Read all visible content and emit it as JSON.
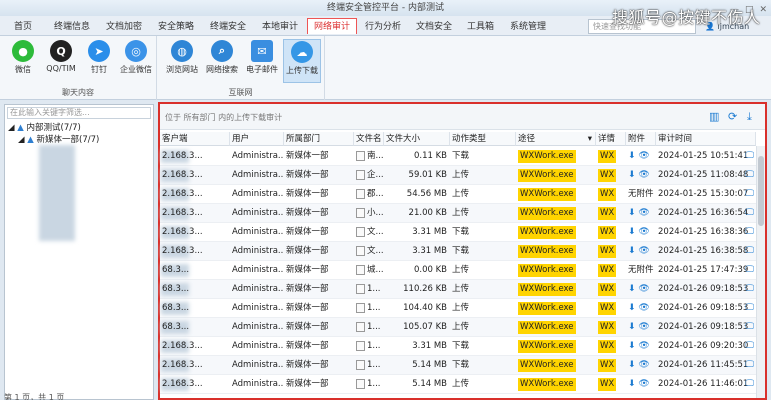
{
  "window": {
    "title": "终端安全管控平台 - 内部测试",
    "watermark": "搜狐号@按键不伤人"
  },
  "menu": {
    "items": [
      "首页",
      "终端信息",
      "文档加密",
      "安全策略",
      "终端安全",
      "本地审计",
      "网络审计",
      "行为分析",
      "文档安全",
      "工具箱",
      "系统管理"
    ],
    "active_index": 6,
    "search_placeholder": "快速查找功能",
    "user": "ljmchan"
  },
  "ribbon": {
    "groups": [
      {
        "label": "聊天内容",
        "buttons": [
          "微信",
          "QQ/TIM",
          "钉钉",
          "企业微信"
        ]
      },
      {
        "label": "互联网",
        "buttons": [
          "浏览网站",
          "网络搜索",
          "电子邮件",
          "上传下载"
        ]
      }
    ],
    "active_button": "上传下载"
  },
  "tree": {
    "search_placeholder": "在此输入关键字筛选...",
    "root": "内部测试(7/7)",
    "child": "新媒体一部(7/7)"
  },
  "main": {
    "breadcrumb": "位于 所有部门 内的上传下载审计",
    "columns": [
      "客户端",
      "用户",
      "所属部门",
      "文件名",
      "文件大小",
      "动作类型",
      "途径",
      "详情",
      "附件",
      "审计时间"
    ],
    "rows": [
      {
        "client": "2.168.3...",
        "user": "Administra...",
        "dept": "新媒体一部",
        "file": "南...",
        "size": "0.11 KB",
        "action": "下载",
        "path": "WXWork.exe",
        "detail": "WX",
        "attach": "icons",
        "time": "2024-01-25 10:51:41"
      },
      {
        "client": "2.168.3...",
        "user": "Administra...",
        "dept": "新媒体一部",
        "file": "企...",
        "size": "59.01 KB",
        "action": "上传",
        "path": "WXWork.exe",
        "detail": "WX",
        "attach": "icons",
        "time": "2024-01-25 11:08:48"
      },
      {
        "client": "2.168.3...",
        "user": "Administra...",
        "dept": "新媒体一部",
        "file": "郡...",
        "size": "54.56 MB",
        "action": "上传",
        "path": "WXWork.exe",
        "detail": "WX",
        "attach": "无附件",
        "time": "2024-01-25 15:30:07"
      },
      {
        "client": "2.168.3...",
        "user": "Administra...",
        "dept": "新媒体一部",
        "file": "小...",
        "size": "21.00 KB",
        "action": "上传",
        "path": "WXWork.exe",
        "detail": "WX",
        "attach": "icons",
        "time": "2024-01-25 16:36:54"
      },
      {
        "client": "2.168.3...",
        "user": "Administra...",
        "dept": "新媒体一部",
        "file": "文...",
        "size": "3.31 MB",
        "action": "下载",
        "path": "WXWork.exe",
        "detail": "WX",
        "attach": "icons",
        "time": "2024-01-25 16:38:36"
      },
      {
        "client": "2.168.3...",
        "user": "Administra...",
        "dept": "新媒体一部",
        "file": "文...",
        "size": "3.31 MB",
        "action": "下载",
        "path": "WXWork.exe",
        "detail": "WX",
        "attach": "icons",
        "time": "2024-01-25 16:38:58"
      },
      {
        "client": "68.3...",
        "user": "Administra...",
        "dept": "新媒体一部",
        "file": "城...",
        "size": "0.00 KB",
        "action": "上传",
        "path": "WXWork.exe",
        "detail": "WX",
        "attach": "无附件",
        "time": "2024-01-25 17:47:39"
      },
      {
        "client": "68.3...",
        "user": "Administra...",
        "dept": "新媒体一部",
        "file": "1...",
        "size": "110.26 KB",
        "action": "上传",
        "path": "WXWork.exe",
        "detail": "WX",
        "attach": "icons",
        "time": "2024-01-26 09:18:53"
      },
      {
        "client": "68.3...",
        "user": "Administra...",
        "dept": "新媒体一部",
        "file": "1...",
        "size": "104.40 KB",
        "action": "上传",
        "path": "WXWork.exe",
        "detail": "WX",
        "attach": "icons",
        "time": "2024-01-26 09:18:53"
      },
      {
        "client": "68.3...",
        "user": "Administra...",
        "dept": "新媒体一部",
        "file": "1...",
        "size": "105.07 KB",
        "action": "上传",
        "path": "WXWork.exe",
        "detail": "WX",
        "attach": "icons",
        "time": "2024-01-26 09:18:53"
      },
      {
        "client": "2.168.3...",
        "user": "Administra...",
        "dept": "新媒体一部",
        "file": "1...",
        "size": "3.31 MB",
        "action": "下载",
        "path": "WXWork.exe",
        "detail": "WX",
        "attach": "icons",
        "time": "2024-01-26 09:20:30"
      },
      {
        "client": "2.168.3...",
        "user": "Administra...",
        "dept": "新媒体一部",
        "file": "1...",
        "size": "5.14 MB",
        "action": "下载",
        "path": "WXWork.exe",
        "detail": "WX",
        "attach": "icons",
        "time": "2024-01-26 11:45:51"
      },
      {
        "client": "2.168.3...",
        "user": "Administra...",
        "dept": "新媒体一部",
        "file": "1...",
        "size": "5.14 MB",
        "action": "上传",
        "path": "WXWork.exe",
        "detail": "WX",
        "attach": "icons",
        "time": "2024-01-26 11:46:01"
      }
    ],
    "pager": "第 1 页，共 1 页"
  }
}
